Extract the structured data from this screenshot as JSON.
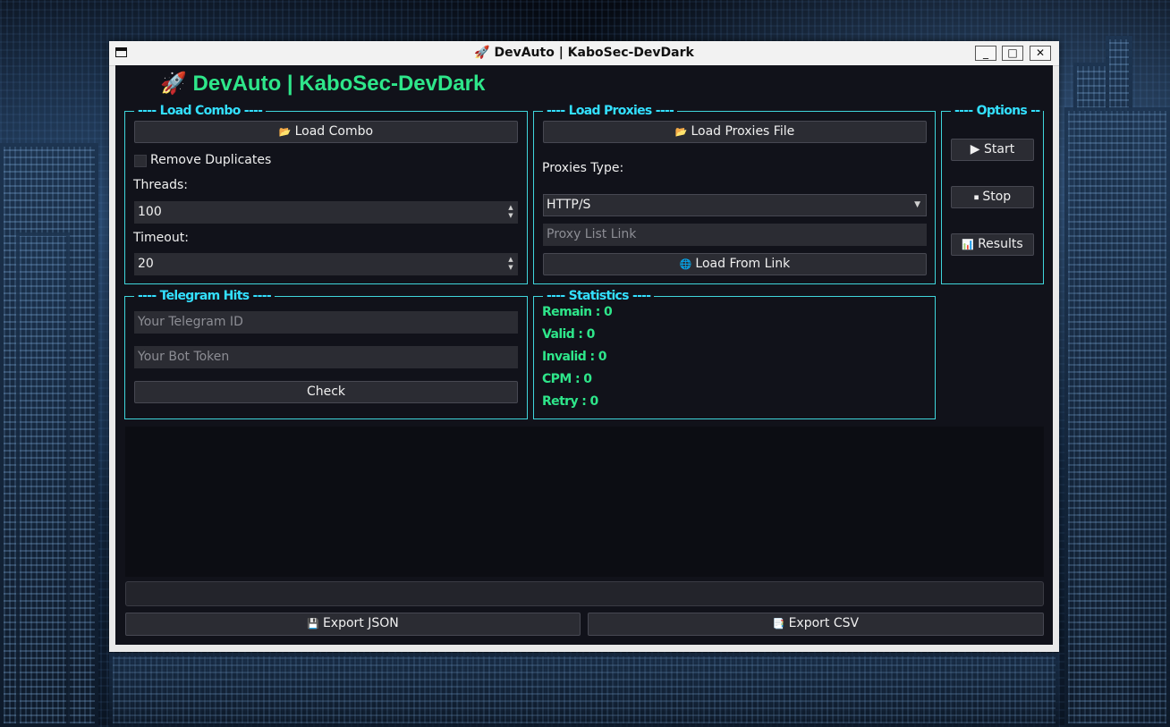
{
  "window": {
    "title": "🚀 DevAuto | KaboSec-DevDark",
    "controls": {
      "minimize": "_",
      "maximize": "□",
      "close": "✕"
    }
  },
  "app": {
    "heading": "🚀 DevAuto | KaboSec-DevDark"
  },
  "load_combo": {
    "title": "---- Load Combo ----",
    "button_icon": "📂",
    "button_label": "Load Combo",
    "remove_duplicates_label": "Remove Duplicates",
    "remove_duplicates_checked": false,
    "threads_label": "Threads:",
    "threads_value": "100",
    "timeout_label": "Timeout:",
    "timeout_value": "20"
  },
  "load_proxies": {
    "title": "---- Load Proxies ----",
    "button_icon": "📂",
    "button_label": "Load Proxies File",
    "type_label": "Proxies Type:",
    "type_selected": "HTTP/S",
    "link_placeholder": "Proxy List Link",
    "link_button_icon": "🌐",
    "link_button_label": "Load From Link"
  },
  "options": {
    "title": "---- Options --",
    "start_label": "▶ Start",
    "stop_icon": "⏹",
    "stop_label": "Stop",
    "results_icon": "📊",
    "results_label": "Results"
  },
  "telegram": {
    "title": "---- Telegram Hits ----",
    "id_placeholder": "Your Telegram ID",
    "token_placeholder": "Your Bot Token",
    "check_label": "Check"
  },
  "statistics": {
    "title": "---- Statistics ----",
    "remain": "Remain : 0",
    "valid": "Valid : 0",
    "invalid": "Invalid : 0",
    "cpm": "CPM : 0",
    "retry": "Retry : 0"
  },
  "export": {
    "json_icon": "💾",
    "json_label": "Export JSON",
    "csv_icon": "📑",
    "csv_label": "Export CSV"
  },
  "colors": {
    "accent_green": "#2ee68a",
    "accent_cyan": "#33e0ff",
    "background": "#11121a"
  }
}
